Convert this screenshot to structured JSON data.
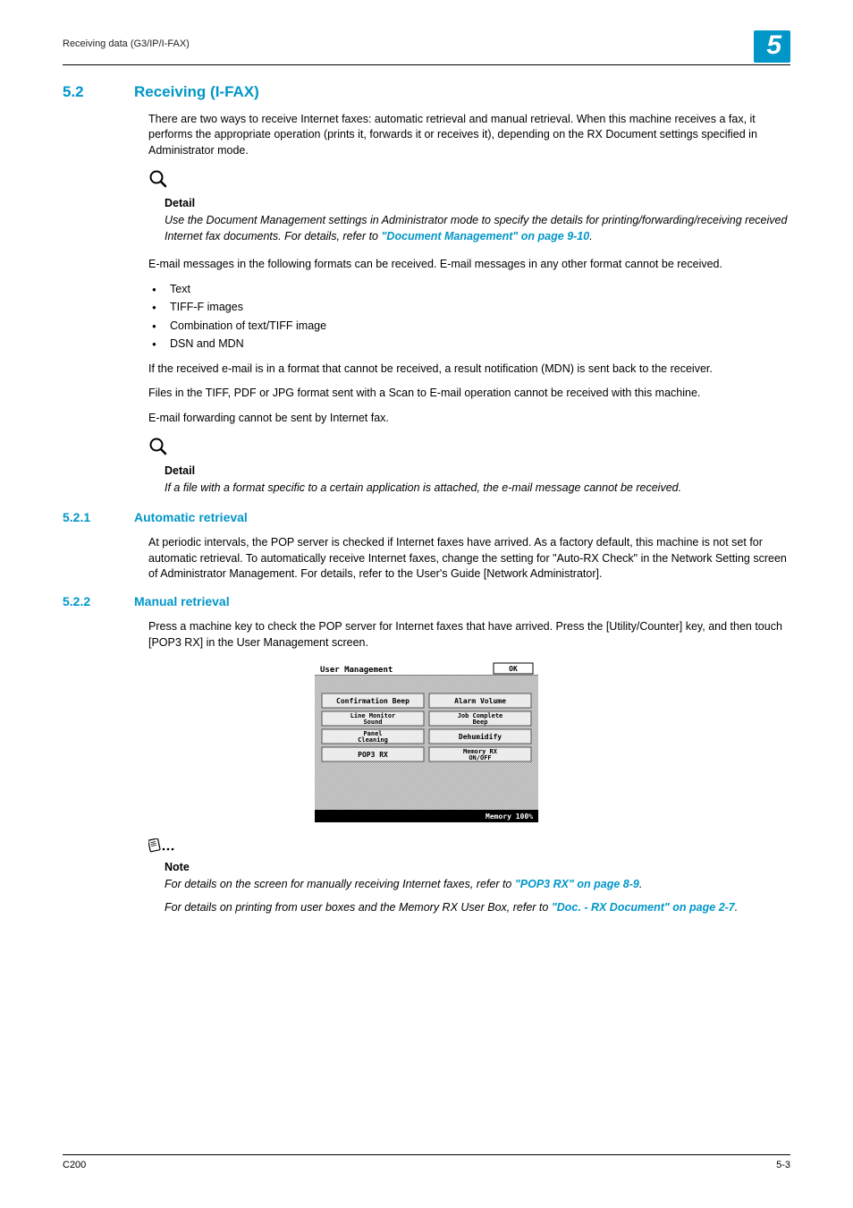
{
  "header": {
    "running": "Receiving data (G3/IP/I-FAX)",
    "chapter": "5"
  },
  "section": {
    "num": "5.2",
    "title": "Receiving (I-FAX)",
    "intro": "There are two ways to receive Internet faxes: automatic retrieval and manual retrieval. When this machine receives a fax, it performs the appropriate operation (prints it, forwards it or receives it), depending on the RX Document settings specified in Administrator mode."
  },
  "detail1": {
    "label": "Detail",
    "body_a": "Use the Document Management settings in Administrator mode to specify the details for printing/forwarding/receiving received Internet fax documents. For details, refer to ",
    "link": "\"Document Management\" on page 9-10",
    "body_b": "."
  },
  "formats": {
    "intro": "E-mail messages in the following formats can be received. E-mail messages in any other format cannot be received.",
    "b1": "Text",
    "b2": "TIFF-F images",
    "b3": "Combination of text/TIFF image",
    "b4": "DSN and MDN",
    "p1": "If the received e-mail is in a format that cannot be received, a result notification (MDN) is sent back to the receiver.",
    "p2": "Files in the TIFF, PDF or JPG format sent with a Scan to E-mail operation cannot be received with this machine.",
    "p3": "E-mail forwarding cannot be sent by Internet fax."
  },
  "detail2": {
    "label": "Detail",
    "body": "If a file with a format specific to a certain application is attached, the e-mail message cannot be received."
  },
  "sub1": {
    "num": "5.2.1",
    "title": "Automatic retrieval",
    "body": "At periodic intervals, the POP server is checked if Internet faxes have arrived. As a factory default, this machine is not set for automatic retrieval. To automatically receive Internet faxes, change the setting for \"Auto-RX Check\" in the Network Setting screen of Administrator Management. For details, refer to the User's Guide [Network Administrator]."
  },
  "sub2": {
    "num": "5.2.2",
    "title": "Manual retrieval",
    "body": "Press a machine key to check the POP server for Internet faxes that have arrived. Press the [Utility/Counter] key, and then touch [POP3 RX] in the User Management screen."
  },
  "lcd": {
    "title": "User Management",
    "ok": "OK",
    "b1": "Confirmation Beep",
    "b2": "Alarm Volume",
    "b3": "Line Monitor Sound",
    "b4": "Job Complete Beep",
    "b5": "Panel Cleaning",
    "b6": "Dehumidify",
    "b7": "POP3 RX",
    "b8a": "Memory RX",
    "b8b": "ON/OFF",
    "mem": "Memory 100%"
  },
  "note": {
    "label": "Note",
    "l1a": "For details on the screen for manually receiving Internet faxes, refer to ",
    "l1link": "\"POP3 RX\" on page 8-9",
    "l1b": ".",
    "l2a": "For details on printing from user boxes and the Memory RX User Box, refer to ",
    "l2link": "\"Doc. - RX Document\" on page 2-7",
    "l2b": "."
  },
  "footer": {
    "left": "C200",
    "right": "5-3"
  }
}
